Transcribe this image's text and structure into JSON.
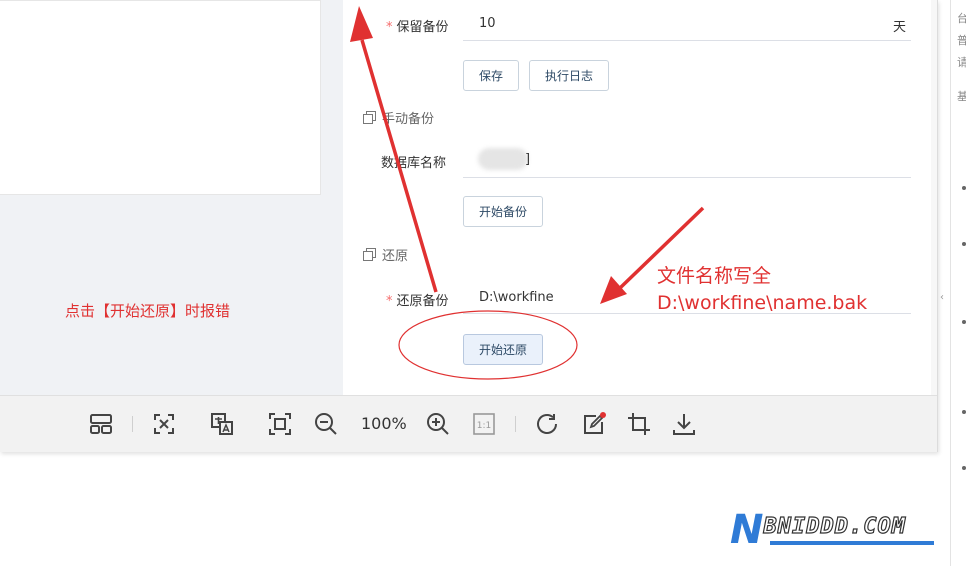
{
  "form": {
    "retention_label": "保留备份",
    "retention_value": "10",
    "retention_unit": "天",
    "save_button": "保存",
    "log_button": "执行日志",
    "manual_section": "手动备份",
    "db_name_label": "数据库名称",
    "db_name_value": "]",
    "start_backup_button": "开始备份",
    "restore_section": "还原",
    "restore_label": "还原备份",
    "restore_value": "D:\\workfine",
    "start_restore_button": "开始还原"
  },
  "notes": {
    "left_note": "点击【开始还原】时报错",
    "annotation_line1": "文件名称写全",
    "annotation_line2": "D:\\workfine\\name.bak"
  },
  "toolbar": {
    "zoom_level": "100%",
    "buttons": [
      "layout-icon",
      "fit-screen-icon",
      "translate-icon",
      "fullscreen-icon",
      "zoom-out-icon",
      "zoom-in-icon",
      "actual-size-icon",
      "rotate-icon",
      "edit-icon",
      "crop-icon",
      "download-icon"
    ]
  },
  "right_strip": {
    "chars": [
      "台",
      "普",
      "请",
      "基"
    ]
  },
  "watermark": {
    "letter": "N",
    "rest": "BNIDDD.COM"
  },
  "colors": {
    "accent_red": "#e03131",
    "required_star": "#f56c6c",
    "watermark_blue": "#2f7bd6",
    "primary_button_bg": "#eaf1fb"
  }
}
